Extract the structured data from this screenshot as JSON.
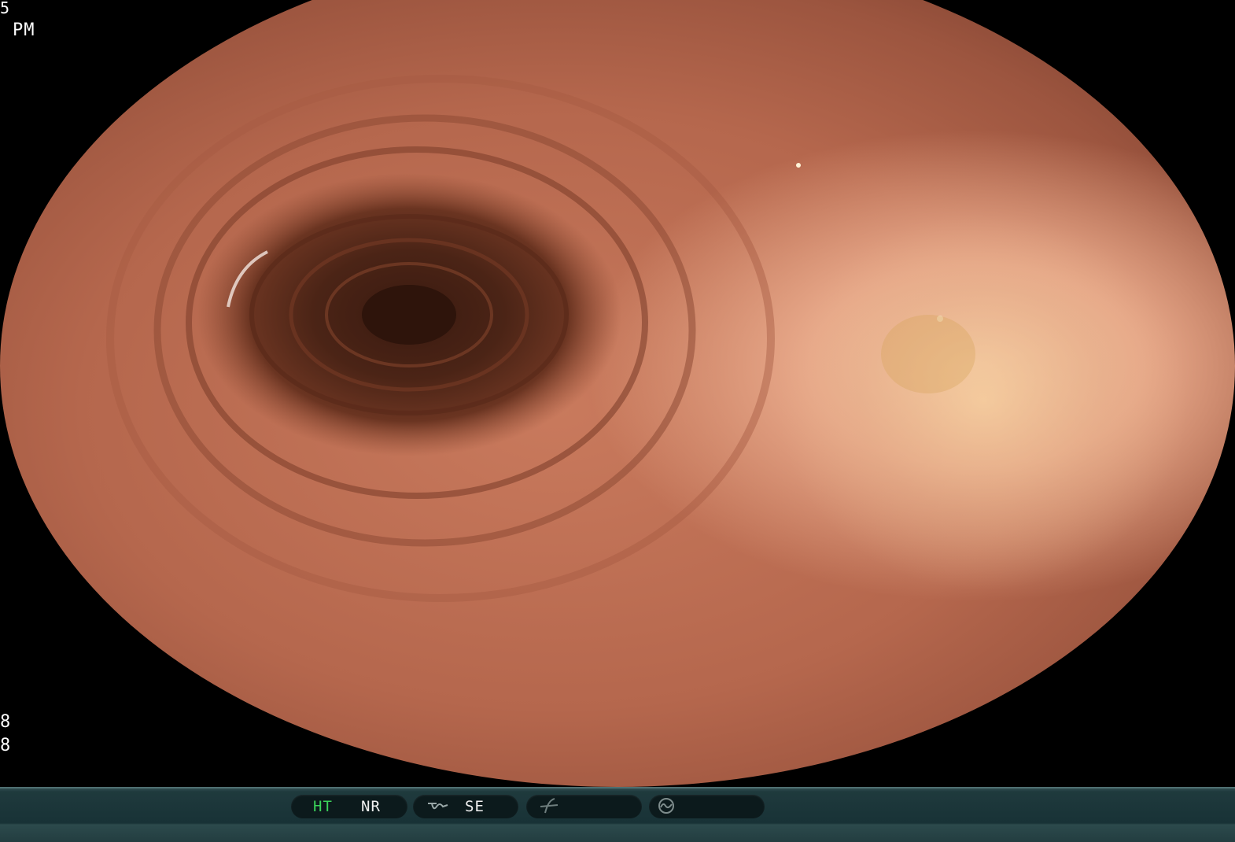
{
  "overlay": {
    "top_line_1": "5",
    "top_line_2": "PM",
    "bottom_line_1": "8",
    "bottom_line_2": "8"
  },
  "status_bar": {
    "ht_label": "HT",
    "nr_label": "NR",
    "se_label": "SE",
    "active_color": "#3bd35a",
    "text_color": "#f0f0f0",
    "icons": [
      "structure-enhance-icon",
      "filter-icon",
      "scope-mode-icon"
    ]
  }
}
